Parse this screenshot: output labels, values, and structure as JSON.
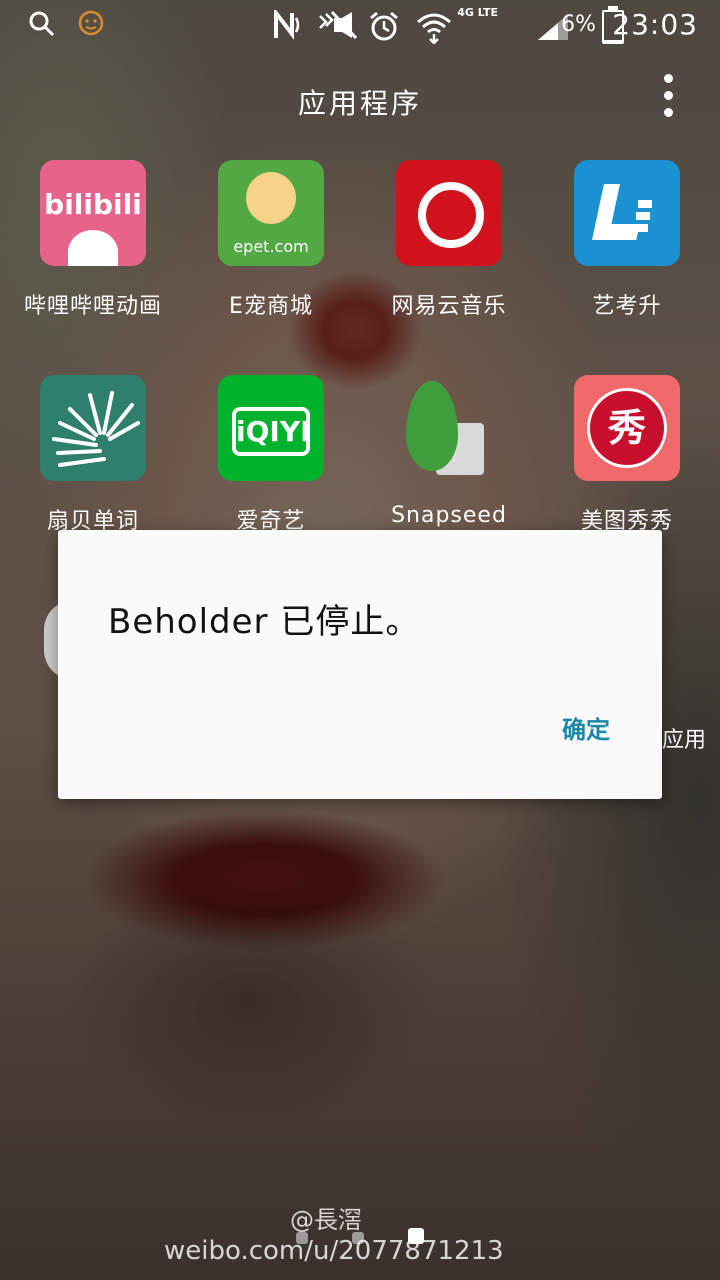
{
  "status_bar": {
    "time": "23:03",
    "battery_percent": "6%",
    "battery_level": 0.06,
    "network": "4G LTE",
    "icons": [
      "search-icon",
      "emoji-icon",
      "nfc-icon",
      "mute-icon",
      "alarm-icon",
      "wifi-icon",
      "signal-icon",
      "battery-icon"
    ]
  },
  "header": {
    "title": "应用程序"
  },
  "apps": [
    {
      "label": "哔哩哔哩动画",
      "icon": "bilibili-icon",
      "tile_text": "bilibili"
    },
    {
      "label": "E宠商城",
      "icon": "epet-icon",
      "tile_text": "epet.com"
    },
    {
      "label": "网易云音乐",
      "icon": "netease-music-icon"
    },
    {
      "label": "艺考升",
      "icon": "yikaosheng-icon"
    },
    {
      "label": "扇贝单词",
      "icon": "shanbay-icon"
    },
    {
      "label": "爱奇艺",
      "icon": "iqiyi-icon",
      "tile_text": "iQIYI"
    },
    {
      "label": "Snapseed",
      "icon": "snapseed-icon"
    },
    {
      "label": "美图秀秀",
      "icon": "meitu-icon",
      "tile_text": "秀"
    }
  ],
  "partial_label": "应用",
  "dialog": {
    "message": "Beholder 已停止。",
    "ok_label": "确定"
  },
  "watermark": {
    "handle": "@長滘",
    "url": "weibo.com/u/2077871213"
  }
}
